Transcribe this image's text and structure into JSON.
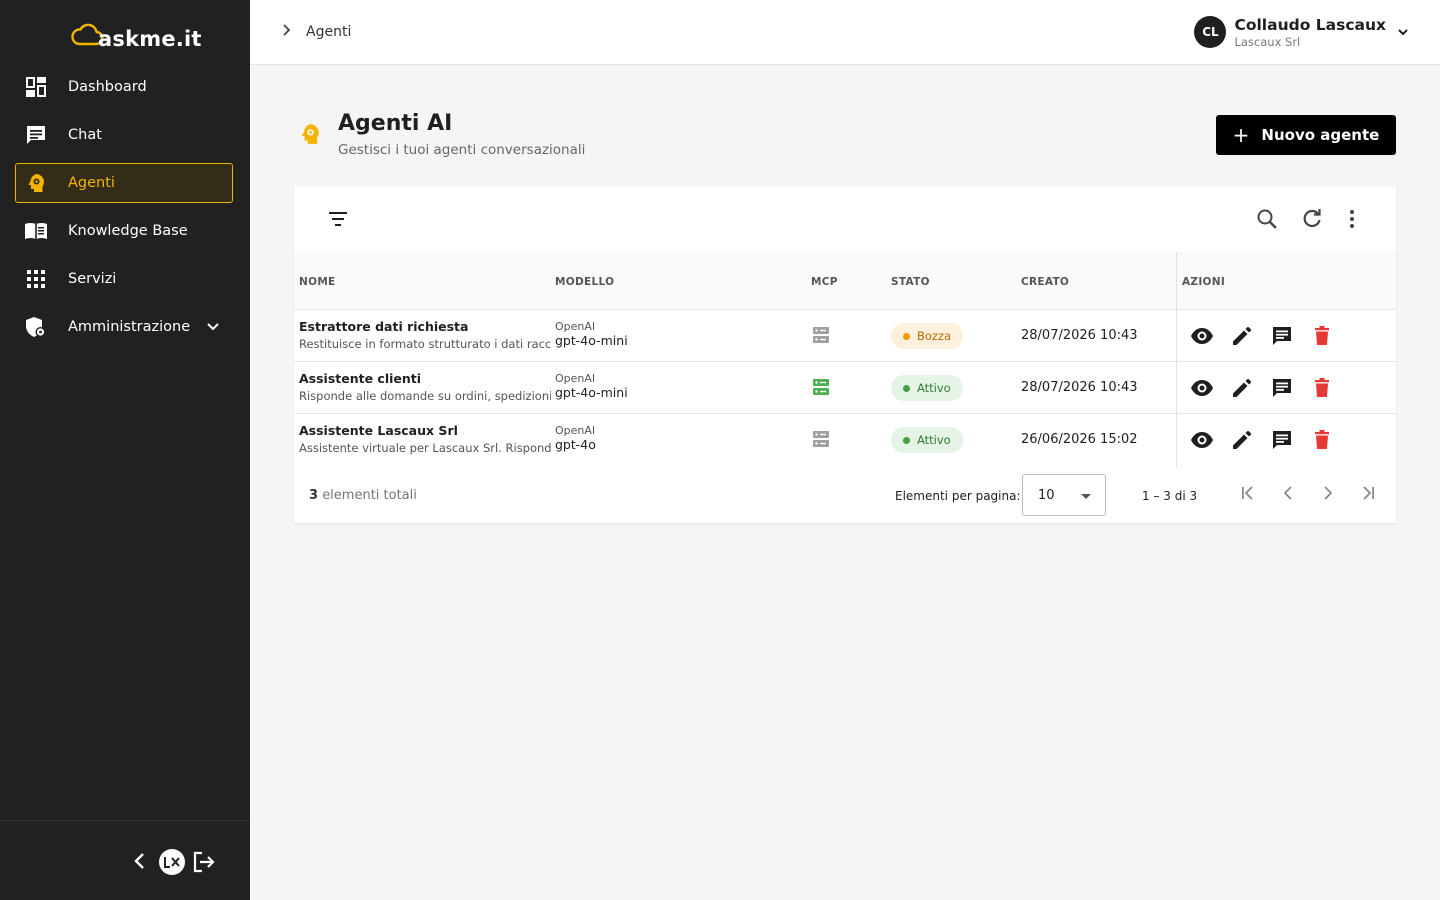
{
  "brand": {
    "logo_text": "askme.it",
    "accent": "#f5b400"
  },
  "sidebar": {
    "items": [
      {
        "label": "Dashboard",
        "icon": "dashboard-icon"
      },
      {
        "label": "Chat",
        "icon": "chat-icon"
      },
      {
        "label": "Agenti",
        "icon": "agent-icon",
        "active": true
      },
      {
        "label": "Knowledge Base",
        "icon": "book-icon"
      },
      {
        "label": "Servizi",
        "icon": "apps-grid-icon"
      },
      {
        "label": "Amministrazione",
        "icon": "admin-icon",
        "expandable": true
      }
    ],
    "footer": {
      "badge_text": "L/X"
    }
  },
  "header": {
    "breadcrumb": "Agenti",
    "user": {
      "initials": "CL",
      "name": "Collaudo Lascaux",
      "org": "Lascaux Srl"
    }
  },
  "page": {
    "title": "Agenti AI",
    "subtitle": "Gestisci i tuoi agenti conversazionali",
    "new_button": "Nuovo agente",
    "new_button_icon": "+"
  },
  "table": {
    "columns": [
      "NOME",
      "MODELLO",
      "MCP",
      "STATO",
      "CREATO",
      "AZIONI"
    ],
    "rows": [
      {
        "name": "Estrattore dati richiesta",
        "description": "Restituisce in formato strutturato i dati raccolti",
        "provider": "OpenAI",
        "model": "gpt-4o-mini",
        "mcp_active": false,
        "status": "Bozza",
        "created": "28/07/2026 10:43"
      },
      {
        "name": "Assistente clienti",
        "description": "Risponde alle domande su ordini, spedizioni, resi",
        "provider": "OpenAI",
        "model": "gpt-4o-mini",
        "mcp_active": true,
        "status": "Attivo",
        "created": "28/07/2026 10:43"
      },
      {
        "name": "Assistente Lascaux Srl",
        "description": "Assistente virtuale per Lascaux Srl. Risponde alle",
        "provider": "OpenAI",
        "model": "gpt-4o",
        "mcp_active": false,
        "status": "Attivo",
        "created": "26/06/2026 15:02"
      }
    ],
    "footer": {
      "total_count": "3",
      "total_label": "elementi totali",
      "per_page_label": "Elementi per pagina:",
      "per_page_value": "10",
      "range": "1 – 3 di 3"
    }
  },
  "colors": {
    "mcp_on": "#4caf50",
    "mcp_off": "#9e9e9e",
    "delete": "#e53935",
    "sidebar_bg": "#212121"
  }
}
